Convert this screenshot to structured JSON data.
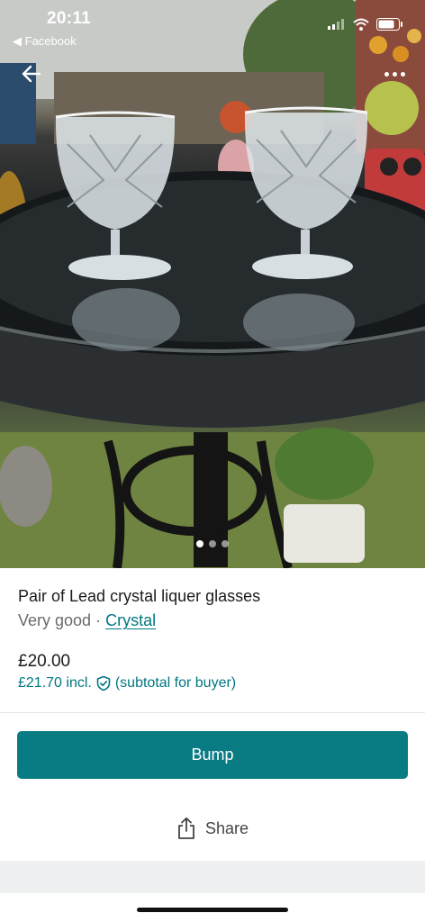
{
  "status_bar": {
    "time": "20:11",
    "back_app": "Facebook"
  },
  "photo": {
    "description_icon": "photo-image",
    "carousel": {
      "count": 3,
      "active_index": 0
    }
  },
  "item": {
    "title": "Pair of Lead crystal liquer glasses",
    "condition": "Very good",
    "separator": "·",
    "brand": "Crystal",
    "price": "£20.00",
    "price_incl": "£21.70 incl.",
    "subtotal_note": "(subtotal for buyer)"
  },
  "actions": {
    "bump_label": "Bump",
    "share_label": "Share"
  },
  "colors": {
    "accent": "#087b83",
    "link": "#007782"
  }
}
